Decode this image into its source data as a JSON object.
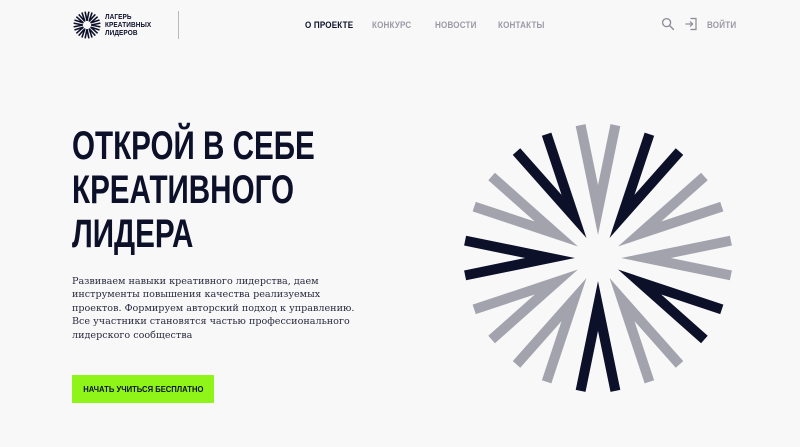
{
  "brand": {
    "logo_lines": [
      "ЛАГЕРЬ",
      "КРЕАТИВНЫХ",
      "ЛИДЕРОВ"
    ]
  },
  "nav": {
    "items": [
      {
        "label": "О ПРОЕКТЕ",
        "active": true
      },
      {
        "label": "КОНКУРС",
        "active": false
      },
      {
        "label": "НОВОСТИ",
        "active": false
      },
      {
        "label": "КОНТАКТЫ",
        "active": false
      }
    ]
  },
  "toolbar": {
    "search_icon": "search-icon",
    "login_icon": "login-icon",
    "login_label": "ВОЙТИ"
  },
  "hero": {
    "title_lines": [
      "ОТКРОЙ В СЕБЕ",
      "КРЕАТИВНОГО",
      "ЛИДЕРА"
    ],
    "description": "Развиваем навыки креативного лидерства, даем инструменты повышения качества реализуемых проектов. Формируем авторский подход к управлению. Все участники становятся частью профессионального лидерского сообщества",
    "cta_label": "НАЧАТЬ УЧИТЬСЯ БЕСПЛАТНО"
  },
  "colors": {
    "background": "#f8f8f9",
    "text_dark": "#0d1029",
    "text_muted": "#9a9aa6",
    "accent": "#8ff519",
    "emblem_dark": "#0d1029",
    "emblem_light": "#a3a3ad"
  },
  "emblem": {
    "name": "sunburst-emblem",
    "pattern": [
      "light",
      "dark",
      "light",
      "light",
      "dark",
      "light",
      "dark",
      "light",
      "light",
      "dark",
      "light",
      "dark"
    ]
  }
}
